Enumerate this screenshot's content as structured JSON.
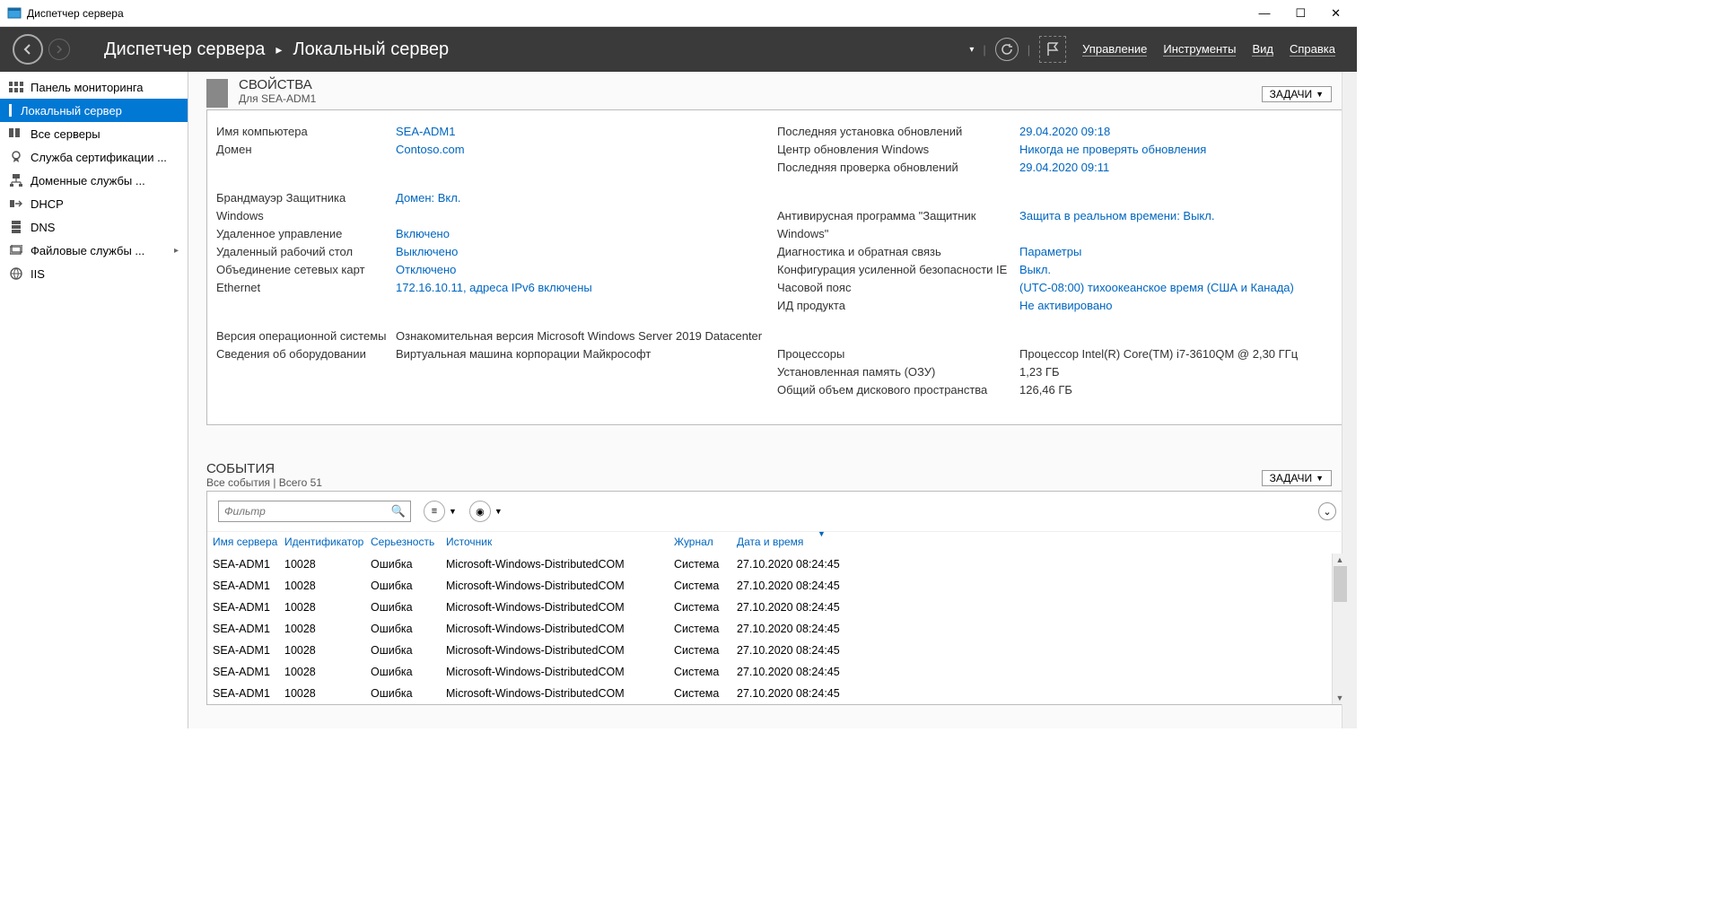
{
  "window": {
    "title": "Диспетчер сервера"
  },
  "ribbon": {
    "breadcrumb_root": "Диспетчер сервера",
    "breadcrumb_page": "Локальный сервер",
    "menu": {
      "manage": "Управление",
      "tools": "Инструменты",
      "view": "Вид",
      "help": "Справка"
    }
  },
  "sidebar": {
    "items": [
      {
        "label": "Панель мониторинга"
      },
      {
        "label": "Локальный сервер"
      },
      {
        "label": "Все серверы"
      },
      {
        "label": "Служба сертификации ..."
      },
      {
        "label": "Доменные службы ..."
      },
      {
        "label": "DHCP"
      },
      {
        "label": "DNS"
      },
      {
        "label": "Файловые службы ..."
      },
      {
        "label": "IIS"
      }
    ]
  },
  "properties": {
    "title": "СВОЙСТВА",
    "subtitle": "Для SEA-ADM1",
    "tasks_label": "ЗАДАЧИ",
    "left": [
      {
        "label": "Имя компьютера",
        "value": "SEA-ADM1",
        "link": true
      },
      {
        "label": "Домен",
        "value": "Contoso.com",
        "link": true
      }
    ],
    "left2": [
      {
        "label": "Брандмауэр Защитника Windows",
        "value": "Домен: Вкл.",
        "link": true
      },
      {
        "label": "Удаленное управление",
        "value": "Включено",
        "link": true
      },
      {
        "label": "Удаленный рабочий стол",
        "value": "Выключено",
        "link": true
      },
      {
        "label": "Объединение сетевых карт",
        "value": "Отключено",
        "link": true
      },
      {
        "label": "Ethernet",
        "value": "172.16.10.11, адреса IPv6 включены",
        "link": true
      }
    ],
    "left3": [
      {
        "label": "Версия операционной системы",
        "value": "Ознакомительная версия Microsoft Windows Server 2019 Datacenter",
        "link": false
      },
      {
        "label": "Сведения об оборудовании",
        "value": "Виртуальная машина корпорации Майкрософт",
        "link": false
      }
    ],
    "right": [
      {
        "label": "Последняя установка обновлений",
        "value": "29.04.2020 09:18",
        "link": true
      },
      {
        "label": "Центр обновления Windows",
        "value": "Никогда не проверять обновления",
        "link": true
      },
      {
        "label": "Последняя проверка обновлений",
        "value": "29.04.2020 09:11",
        "link": true
      }
    ],
    "right2": [
      {
        "label": "Антивирусная программа \"Защитник Windows\"",
        "value": "Защита в реальном времени: Выкл.",
        "link": true
      },
      {
        "label": "Диагностика и обратная связь",
        "value": "Параметры",
        "link": true
      },
      {
        "label": "Конфигурация усиленной безопасности IE",
        "value": "Выкл.",
        "link": true
      },
      {
        "label": "Часовой пояс",
        "value": "(UTC-08:00) тихоокеанское время (США и Канада)",
        "link": true
      },
      {
        "label": "ИД продукта",
        "value": "Не активировано",
        "link": true
      }
    ],
    "right3": [
      {
        "label": "Процессоры",
        "value": "Процессор Intel(R) Core(TM) i7-3610QM @ 2,30 ГГц",
        "link": false
      },
      {
        "label": "Установленная память (ОЗУ)",
        "value": "1,23 ГБ",
        "link": false
      },
      {
        "label": "Общий объем дискового пространства",
        "value": "126,46 ГБ",
        "link": false
      }
    ]
  },
  "events": {
    "title": "СОБЫТИЯ",
    "subtitle": "Все события | Всего 51",
    "tasks_label": "ЗАДАЧИ",
    "filter_placeholder": "Фильтр",
    "columns": {
      "server": "Имя сервера",
      "id": "Идентификатор",
      "sev": "Серьезность",
      "src": "Источник",
      "log": "Журнал",
      "date": "Дата и время"
    },
    "rows": [
      {
        "server": "SEA-ADM1",
        "id": "10028",
        "sev": "Ошибка",
        "src": "Microsoft-Windows-DistributedCOM",
        "log": "Система",
        "date": "27.10.2020 08:24:45"
      },
      {
        "server": "SEA-ADM1",
        "id": "10028",
        "sev": "Ошибка",
        "src": "Microsoft-Windows-DistributedCOM",
        "log": "Система",
        "date": "27.10.2020 08:24:45"
      },
      {
        "server": "SEA-ADM1",
        "id": "10028",
        "sev": "Ошибка",
        "src": "Microsoft-Windows-DistributedCOM",
        "log": "Система",
        "date": "27.10.2020 08:24:45"
      },
      {
        "server": "SEA-ADM1",
        "id": "10028",
        "sev": "Ошибка",
        "src": "Microsoft-Windows-DistributedCOM",
        "log": "Система",
        "date": "27.10.2020 08:24:45"
      },
      {
        "server": "SEA-ADM1",
        "id": "10028",
        "sev": "Ошибка",
        "src": "Microsoft-Windows-DistributedCOM",
        "log": "Система",
        "date": "27.10.2020 08:24:45"
      },
      {
        "server": "SEA-ADM1",
        "id": "10028",
        "sev": "Ошибка",
        "src": "Microsoft-Windows-DistributedCOM",
        "log": "Система",
        "date": "27.10.2020 08:24:45"
      },
      {
        "server": "SEA-ADM1",
        "id": "10028",
        "sev": "Ошибка",
        "src": "Microsoft-Windows-DistributedCOM",
        "log": "Система",
        "date": "27.10.2020 08:24:45"
      }
    ]
  }
}
